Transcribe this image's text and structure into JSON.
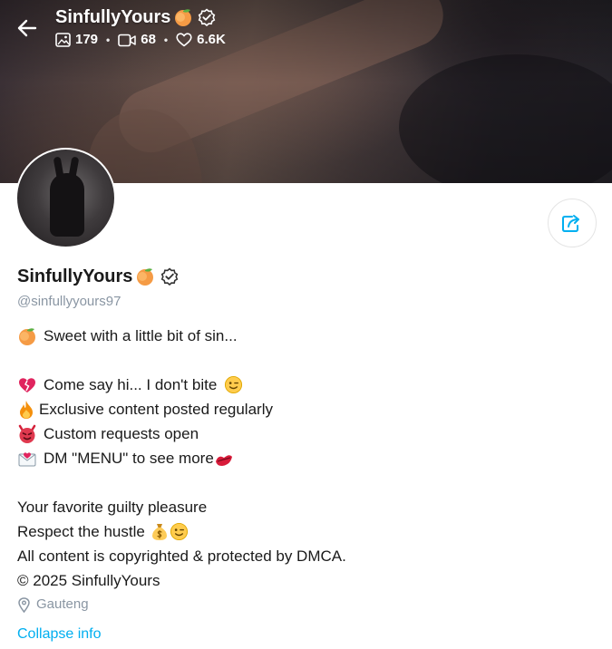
{
  "header": {
    "title": "SinfullyYours",
    "stats": {
      "photos": "179",
      "videos": "68",
      "likes": "6.6K"
    }
  },
  "profile": {
    "name": "SinfullyYours",
    "handle": "@sinfullyyours97",
    "location": "Gauteng",
    "collapse_label": "Collapse info"
  },
  "bio": {
    "line1": "Sweet with a little bit of sin...",
    "line2": "Come say hi... I don't bite",
    "line3": "Exclusive content posted regularly",
    "line4": "Custom requests open",
    "line5": "DM \"MENU\" to see more",
    "line6": "Your favorite guilty pleasure",
    "line7": "Respect the hustle",
    "line8": "All content is copyrighted & protected by DMCA.",
    "line9": "© 2025 SinfullyYours"
  },
  "icons": {
    "back": "arrow-left-icon",
    "verified": "verified-badge-icon",
    "photo": "image-icon",
    "video": "video-icon",
    "like": "heart-icon",
    "share": "share-icon",
    "location": "location-pin-icon"
  },
  "colors": {
    "accent": "#00aff0",
    "muted": "#8a96a3",
    "text": "#1a1a1a"
  }
}
